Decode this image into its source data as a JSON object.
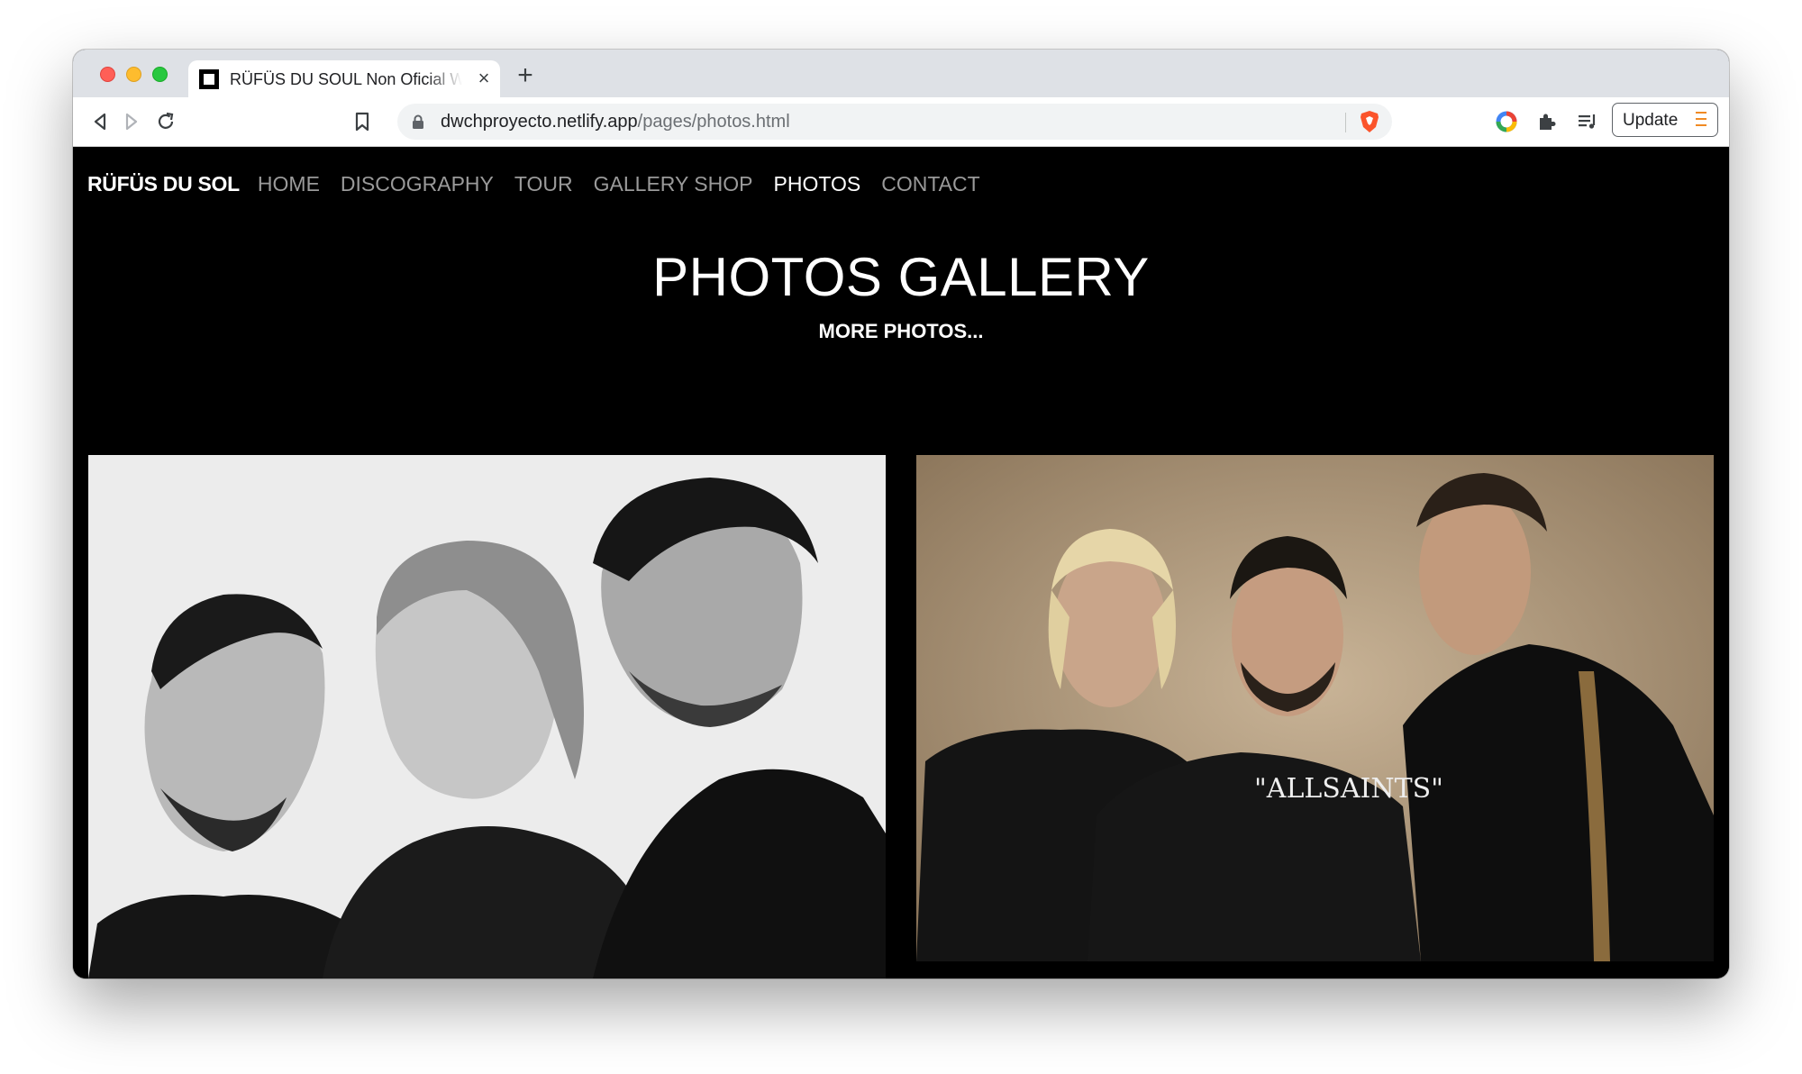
{
  "browser": {
    "tab": {
      "title": "RÜFÜS DU SOUL Non Oficial Web",
      "close_symbol": "×"
    },
    "new_tab_symbol": "+",
    "url": {
      "host": "dwchproyecto.netlify.app",
      "path": "/pages/photos.html"
    },
    "update_label": "Update"
  },
  "site": {
    "brand": "RÜFÜS DU SOL",
    "nav": [
      {
        "label": "HOME",
        "active": false
      },
      {
        "label": "DISCOGRAPHY",
        "active": false
      },
      {
        "label": "TOUR",
        "active": false
      },
      {
        "label": "GALLERY SHOP",
        "active": false
      },
      {
        "label": "PHOTOS",
        "active": true
      },
      {
        "label": "CONTACT",
        "active": false
      }
    ],
    "title": "PHOTOS GALLERY",
    "subtitle": "MORE PHOTOS...",
    "photo_shirt_text": "\"ALLSAINTS\""
  },
  "colors": {
    "page_bg": "#000000",
    "nav_inactive": "#9a9a9a",
    "nav_active": "#ffffff",
    "tabstrip_bg": "#dee1e6"
  }
}
